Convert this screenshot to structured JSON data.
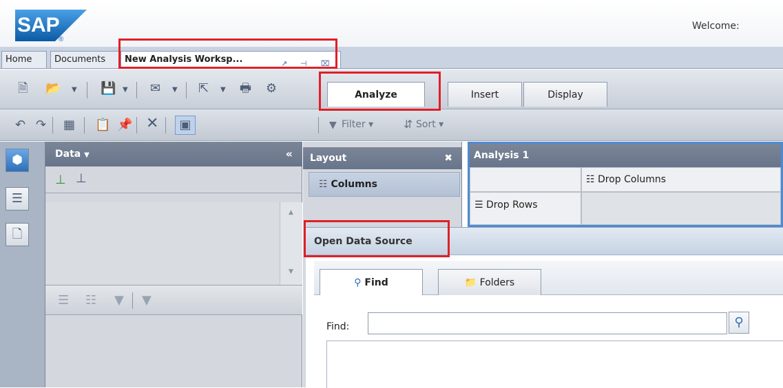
{
  "header": {
    "brand": "SAP",
    "welcome": "Welcome:"
  },
  "doc_tabs": [
    {
      "label": "Home"
    },
    {
      "label": "Documents"
    },
    {
      "label": "New Analysis Worksp..."
    }
  ],
  "ribbon_tabs": [
    {
      "label": "Analyze"
    },
    {
      "label": "Insert"
    },
    {
      "label": "Display"
    }
  ],
  "toolbar2": {
    "filter_label": "Filter",
    "sort_label": "Sort"
  },
  "data_panel": {
    "title": "Data"
  },
  "layout_panel": {
    "title": "Layout",
    "columns_label": "Columns"
  },
  "analysis": {
    "title": "Analysis 1",
    "drop_columns": "Drop Columns",
    "drop_rows": "Drop Rows"
  },
  "dialog": {
    "title": "Open Data Source",
    "find_tab": "Find",
    "folders_tab": "Folders",
    "find_label": "Find:",
    "find_value": ""
  },
  "colors": {
    "highlight": "#e01f26",
    "accent": "#4f8ad0",
    "sap_blue": "#1d6bbf"
  }
}
